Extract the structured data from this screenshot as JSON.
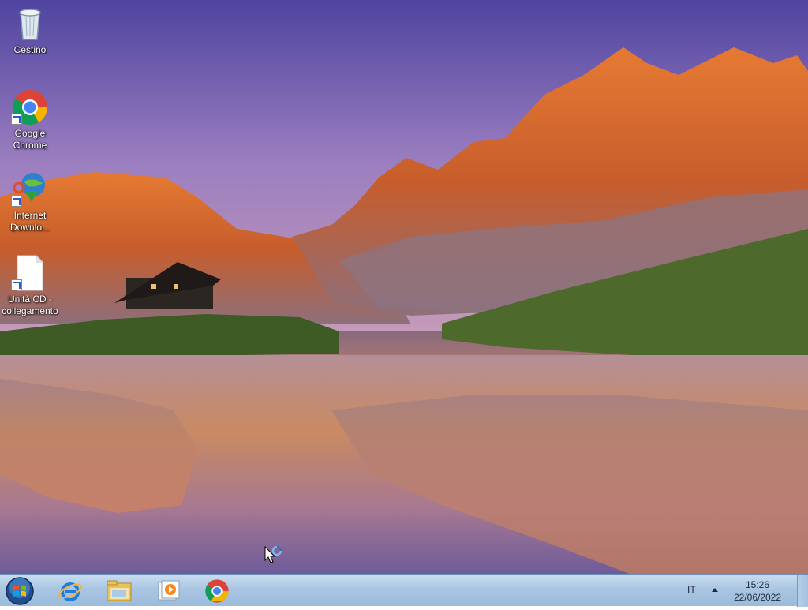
{
  "desktop": {
    "icons": [
      {
        "label": "Cestino",
        "icon": "recycle-bin-icon"
      },
      {
        "label": "Google\nChrome",
        "icon": "chrome-icon"
      },
      {
        "label": "Internet\nDownlo...",
        "icon": "internet-download-manager-icon"
      },
      {
        "label": "Unità CD -\ncollegamento",
        "icon": "file-shortcut-icon"
      }
    ]
  },
  "taskbar": {
    "start": "start-orb-icon",
    "pinned": [
      {
        "name": "internet-explorer-icon"
      },
      {
        "name": "file-explorer-icon"
      },
      {
        "name": "media-player-icon"
      },
      {
        "name": "chrome-icon"
      }
    ],
    "tray": {
      "language": "IT",
      "time": "15:26",
      "date": "22/06/2022"
    }
  },
  "colors": {
    "taskbar": "#a9c5e2",
    "sky": "#7d67b0",
    "rock": "#d86a30"
  }
}
